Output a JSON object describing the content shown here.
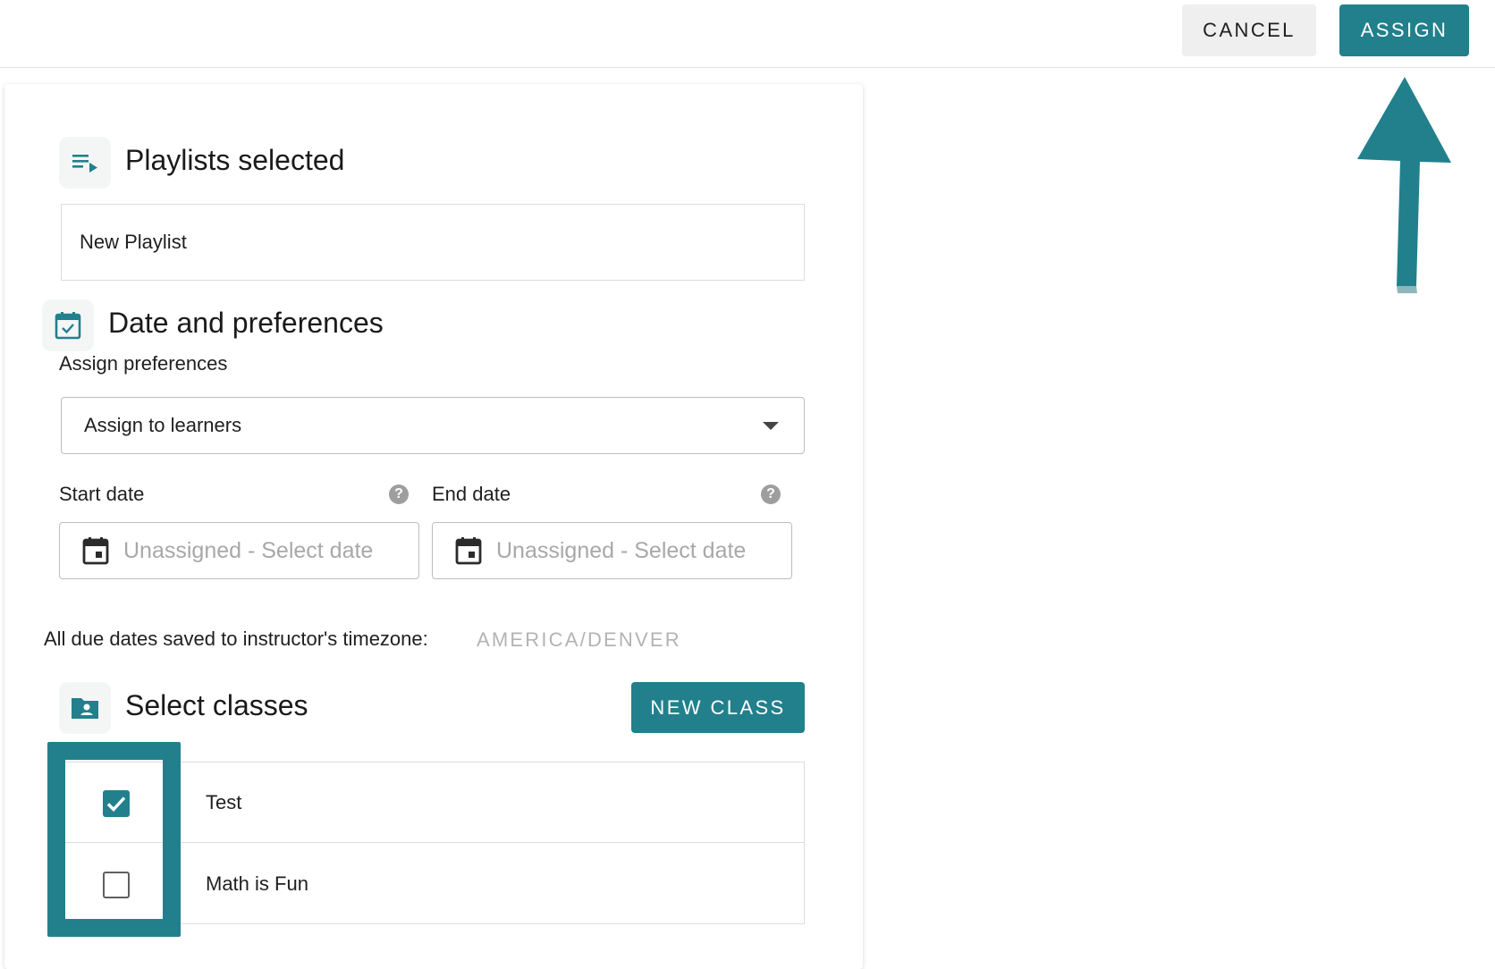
{
  "topbar": {
    "cancel_label": "CANCEL",
    "assign_label": "ASSIGN"
  },
  "playlists": {
    "title": "Playlists selected",
    "icon": "playlist-play-icon",
    "items": [
      "New Playlist"
    ]
  },
  "dates": {
    "title": "Date and preferences",
    "icon": "calendar-check-icon",
    "assign_pref_label": "Assign preferences",
    "assign_pref_value": "Assign to learners",
    "start_label": "Start date",
    "end_label": "End date",
    "start_placeholder": "Unassigned - Select date",
    "end_placeholder": "Unassigned - Select date",
    "timezone_label": "All due dates saved to instructor's timezone:",
    "timezone_value": "AMERICA/DENVER"
  },
  "classes": {
    "title": "Select classes",
    "icon": "folder-user-icon",
    "new_class_label": "NEW CLASS",
    "rows": [
      {
        "name": "Test",
        "checked": true
      },
      {
        "name": "Math is Fun",
        "checked": false
      }
    ]
  },
  "colors": {
    "accent": "#22808c",
    "placeholder": "#a8a8a8",
    "muted": "#b3b3b3"
  }
}
